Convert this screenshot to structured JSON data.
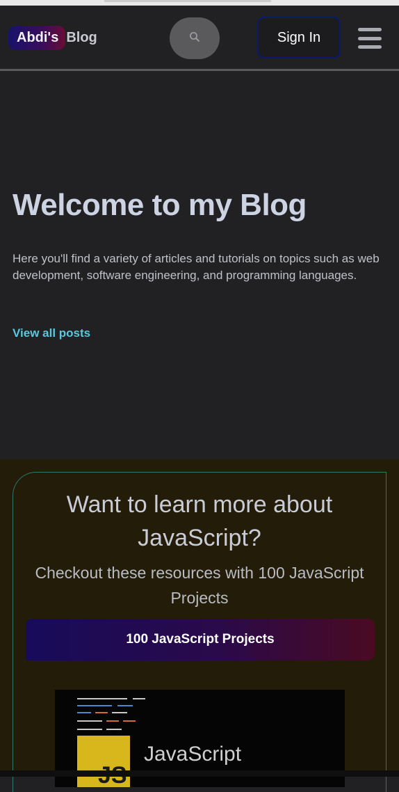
{
  "header": {
    "brand_primary": "Abdi's",
    "brand_secondary": "Blog",
    "signin_label": "Sign In"
  },
  "hero": {
    "title": "Welcome to my Blog",
    "description": "Here you'll find a variety of articles and tutorials on topics such as web development, software engineering, and programming languages.",
    "link_label": "View all posts"
  },
  "promo": {
    "title": "Want to learn more about JavaScript?",
    "subtitle": "Checkout these resources with 100 JavaScript Projects",
    "button_label": "100 JavaScript Projects",
    "thumb_badge": "JS",
    "thumb_title": "JavaScript"
  },
  "colors": {
    "accent_link": "#5cc6dc",
    "heading": "#cdd3e3",
    "brand_gradient_start": "#17126a",
    "brand_gradient_end": "#6a0d35",
    "promo_bg": "#231c08",
    "card_border": "#2e7a6a",
    "js_yellow": "#d7b71c"
  },
  "icons": {
    "search": "search-icon",
    "menu": "hamburger-menu-icon"
  }
}
